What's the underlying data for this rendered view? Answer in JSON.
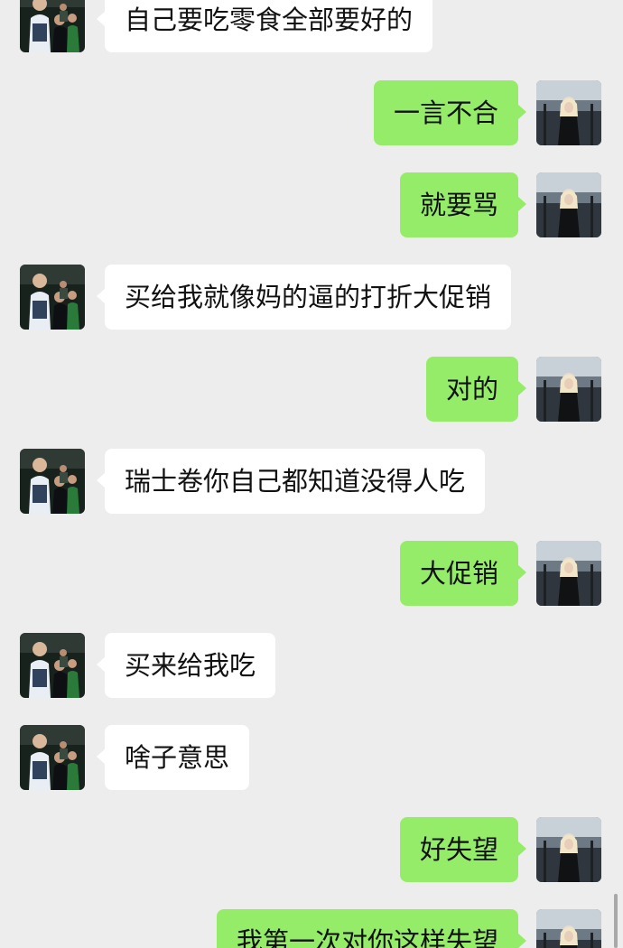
{
  "messages": [
    {
      "side": "left",
      "text": "自己要吃零食全部要好的"
    },
    {
      "side": "right",
      "text": "一言不合"
    },
    {
      "side": "right",
      "text": "就要骂"
    },
    {
      "side": "left",
      "text": "买给我就像妈的逼的打折大促销"
    },
    {
      "side": "right",
      "text": "对的"
    },
    {
      "side": "left",
      "text": "瑞士卷你自己都知道没得人吃"
    },
    {
      "side": "right",
      "text": "大促销"
    },
    {
      "side": "left",
      "text": "买来给我吃"
    },
    {
      "side": "left",
      "text": "啥子意思"
    },
    {
      "side": "right",
      "text": "好失望"
    },
    {
      "side": "right",
      "text": "我第一次对你这样失望"
    }
  ],
  "colors": {
    "background": "#ededed",
    "sent_bubble": "#95ec69",
    "received_bubble": "#ffffff",
    "text": "#111111"
  },
  "icons": {
    "left_avatar": "contact-photo-icon",
    "right_avatar": "self-photo-icon"
  }
}
